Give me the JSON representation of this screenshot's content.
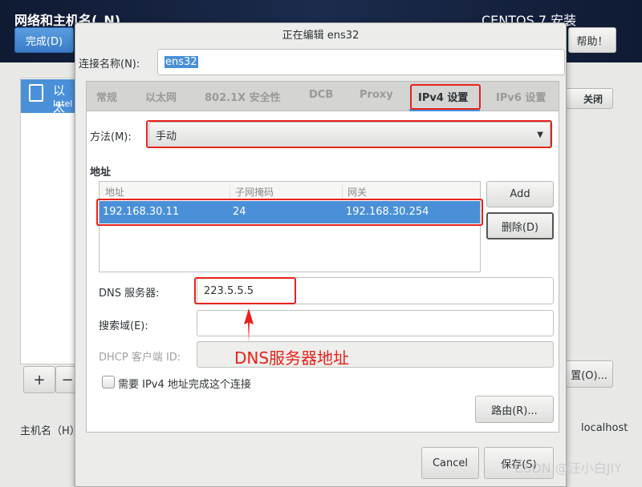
{
  "header": {
    "title": "网络和主机名(_N)",
    "done_label": "完成(D)",
    "product": "CENTOS 7 安装",
    "help_label": "帮助！"
  },
  "left": {
    "device_name": "以太",
    "device_desc": "Intel (",
    "add_label": "+",
    "remove_label": "−",
    "hostname_label": "主机名（H）"
  },
  "right": {
    "close_label": "关闭",
    "configure_label": "置(O)...",
    "hostname_value": "localhost"
  },
  "dialog": {
    "title": "正在编辑 ens32",
    "conn_name_label": "连接名称(N):",
    "conn_name_value": "ens32",
    "tabs": [
      {
        "label": "常规"
      },
      {
        "label": "以太网"
      },
      {
        "label": "802.1X 安全性"
      },
      {
        "label": "DCB"
      },
      {
        "label": "Proxy"
      },
      {
        "label": "IPv4 设置"
      },
      {
        "label": "IPv6 设置"
      }
    ],
    "active_tab": "IPv4 设置",
    "method_label": "方法(M):",
    "method_value": "手动",
    "address_heading": "地址",
    "table": {
      "columns": [
        "地址",
        "子网掩码",
        "网关"
      ],
      "rows": [
        [
          "192.168.30.11",
          "24",
          "192.168.30.254"
        ]
      ]
    },
    "add_label": "Add",
    "delete_label": "删除(D)",
    "dns_label": "DNS 服务器:",
    "dns_value": "223.5.5.5",
    "search_label": "搜索域(E):",
    "search_value": "",
    "dhcp_label": "DHCP 客户端 ID:",
    "dhcp_value": "",
    "require_ipv4_label": "需要 IPv4 地址完成这个连接",
    "require_ipv4_checked": false,
    "routes_label": "路由(R)...",
    "cancel_label": "Cancel",
    "save_label": "保存(S)"
  },
  "annotation": {
    "text": "DNS服务器地址",
    "color": "#e8221b"
  },
  "watermark": "CSDN @汪小白JIY",
  "colors": {
    "accent": "#4a90d9",
    "header": "#152340",
    "highlight": "#e8221b"
  }
}
